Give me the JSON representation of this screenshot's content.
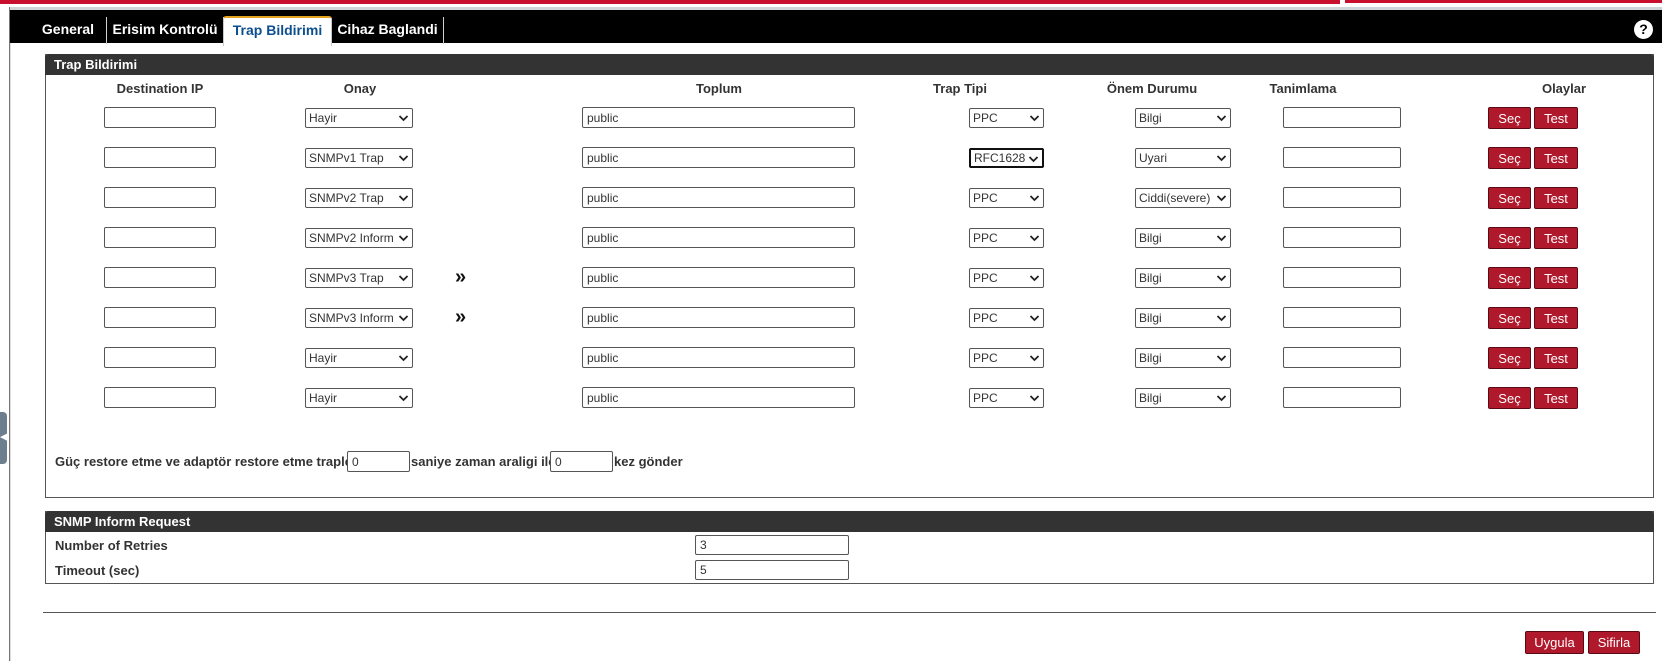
{
  "tabs": [
    {
      "label": "General",
      "active": false
    },
    {
      "label": "Erisim Kontrolü",
      "active": false
    },
    {
      "label": "Trap Bildirimi",
      "active": true
    },
    {
      "label": "Cihaz Baglandi",
      "active": false
    }
  ],
  "help_icon": "question-mark-icon",
  "trap_section": {
    "title": "Trap Bildirimi",
    "columns": {
      "destination_ip": "Destination IP",
      "onay": "Onay",
      "toplum": "Toplum",
      "trap_tipi": "Trap Tipi",
      "onem_durumu": "Önem Durumu",
      "tanimlama": "Tanimlama",
      "olaylar": "Olaylar"
    },
    "rows": [
      {
        "destination_ip": "",
        "onay": "Hayir",
        "arrow": "",
        "toplum": "public",
        "trap_tipi": "PPC",
        "onem": "Bilgi",
        "tanimlama": "",
        "sec_label": "Seç",
        "test_label": "Test"
      },
      {
        "destination_ip": "",
        "onay": "SNMPv1 Trap",
        "arrow": "",
        "toplum": "public",
        "trap_tipi": "RFC1628",
        "onem": "Uyari",
        "tanimlama": "",
        "sec_label": "Seç",
        "test_label": "Test"
      },
      {
        "destination_ip": "",
        "onay": "SNMPv2 Trap",
        "arrow": "",
        "toplum": "public",
        "trap_tipi": "PPC",
        "onem": "Ciddi(severe)",
        "tanimlama": "",
        "sec_label": "Seç",
        "test_label": "Test"
      },
      {
        "destination_ip": "",
        "onay": "SNMPv2 Inform",
        "arrow": "",
        "toplum": "public",
        "trap_tipi": "PPC",
        "onem": "Bilgi",
        "tanimlama": "",
        "sec_label": "Seç",
        "test_label": "Test"
      },
      {
        "destination_ip": "",
        "onay": "SNMPv3 Trap",
        "arrow": "»",
        "toplum": "public",
        "trap_tipi": "PPC",
        "onem": "Bilgi",
        "tanimlama": "",
        "sec_label": "Seç",
        "test_label": "Test"
      },
      {
        "destination_ip": "",
        "onay": "SNMPv3 Inform",
        "arrow": "»",
        "toplum": "public",
        "trap_tipi": "PPC",
        "onem": "Bilgi",
        "tanimlama": "",
        "sec_label": "Seç",
        "test_label": "Test"
      },
      {
        "destination_ip": "",
        "onay": "Hayir",
        "arrow": "",
        "toplum": "public",
        "trap_tipi": "PPC",
        "onem": "Bilgi",
        "tanimlama": "",
        "sec_label": "Seç",
        "test_label": "Test"
      },
      {
        "destination_ip": "",
        "onay": "Hayir",
        "arrow": "",
        "toplum": "public",
        "trap_tipi": "PPC",
        "onem": "Bilgi",
        "tanimlama": "",
        "sec_label": "Seç",
        "test_label": "Test"
      }
    ],
    "restore": {
      "text_before": "Güç restore etme ve adaptör restore etme traplerini",
      "interval_value": "0",
      "text_middle": "saniye zaman araligi ile",
      "count_value": "0",
      "text_after": "kez gönder"
    }
  },
  "snmp_inform": {
    "title": "SNMP Inform Request",
    "retries_label": "Number of Retries",
    "retries_value": "3",
    "timeout_label": "Timeout (sec)",
    "timeout_value": "5"
  },
  "footer": {
    "apply_label": "Uygula",
    "reset_label": "Sifirla"
  },
  "colors": {
    "accent_red": "#b0182b",
    "header_dark": "#333333",
    "active_tab_text": "#0c4f8f",
    "active_tab_border": "#e2a21c"
  }
}
